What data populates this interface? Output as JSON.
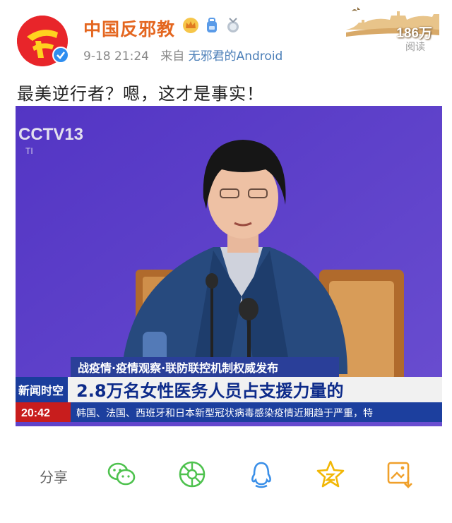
{
  "author": {
    "name": "中国反邪教",
    "badges": [
      "crown-icon",
      "backpack-icon",
      "medal-icon"
    ]
  },
  "meta": {
    "time": "9-18 21:24",
    "from_prefix": "来自",
    "source": "无邪君的Android"
  },
  "reads": {
    "count": "186万",
    "label": "阅读"
  },
  "post": {
    "text": "最美逆行者？嗯，这才是事实！"
  },
  "video": {
    "channel_logo": "CCTV13",
    "channel_sub": "TI",
    "banner_top": "战疫情·疫情观察·联防联控机制权威发布",
    "show_tag": "新闻时空",
    "headline": "2.8万名女性医务人员占支援力量的",
    "clock": "20:42",
    "ticker": "韩国、法国、西班牙和日本新型冠状病毒感染疫情近期趋于严重，特"
  },
  "actions": {
    "share_label": "分享",
    "icons": [
      "wechat-icon",
      "moments-icon",
      "qq-icon",
      "qzone-icon",
      "save-image-icon"
    ]
  },
  "colors": {
    "author": "#e4661f",
    "icon_green": "#4ec24e",
    "icon_blue": "#3a8fe8",
    "icon_yellow": "#f2b705",
    "icon_orange": "#f0a02a"
  }
}
